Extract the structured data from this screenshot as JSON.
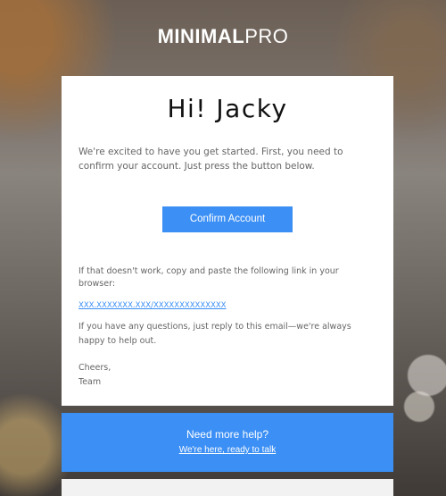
{
  "brand": {
    "bold": "MINIMAL",
    "light": "PRO"
  },
  "card": {
    "greeting": "Hi! Jacky",
    "intro": "We're excited to have you get started. First, you need to confirm your account. Just press the button below.",
    "button_label": "Confirm Account",
    "fallback_text": "If that doesn't work, copy and paste the following link in your browser:",
    "link_text": "XXX.XXXXXXX.XXX/XXXXXXXXXXXXXX",
    "questions_text": "If you have any questions, just reply to this email—we're always happy to help out.",
    "signoff": "Cheers,",
    "signature": "Team"
  },
  "help": {
    "title": "Need more help?",
    "link_text": "We're here, ready to talk"
  },
  "colors": {
    "accent": "#3b8ff5",
    "card_bg": "#ffffff",
    "body_text": "#666666",
    "heading_text": "#111111"
  }
}
